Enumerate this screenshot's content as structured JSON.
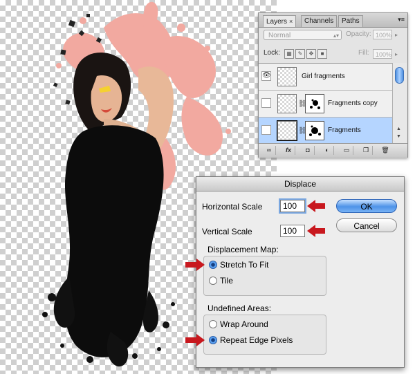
{
  "layers_panel": {
    "tabs": [
      {
        "label": "Layers",
        "close": "×",
        "active": true
      },
      {
        "label": "Channels",
        "active": false
      },
      {
        "label": "Paths",
        "active": false
      }
    ],
    "menu_glyph": "▾≡",
    "blend_mode": "Normal",
    "opacity_label": "Opacity:",
    "opacity_value": "100%",
    "lock_label": "Lock:",
    "fill_label": "Fill:",
    "fill_value": "100%",
    "layers": [
      {
        "name": "Girl fragments",
        "visible": true,
        "has_mask": false,
        "selected": false
      },
      {
        "name": "Fragments copy",
        "visible": false,
        "has_mask": true,
        "selected": false
      },
      {
        "name": "Fragments",
        "visible": false,
        "has_mask": true,
        "selected": true
      }
    ],
    "bottom_icons": [
      "link-icon",
      "fx-icon",
      "mask-icon",
      "adjustment-icon",
      "group-icon",
      "new-layer-icon",
      "trash-icon"
    ],
    "bottom_glyphs": [
      "∞",
      "fx",
      "◘",
      "◐",
      "▭",
      "❐",
      "🗑"
    ]
  },
  "displace_dialog": {
    "title": "Displace",
    "horizontal_scale_label": "Horizontal Scale",
    "horizontal_scale_value": "100",
    "vertical_scale_label": "Vertical Scale",
    "vertical_scale_value": "100",
    "ok_label": "OK",
    "cancel_label": "Cancel",
    "displacement_map_label": "Displacement Map:",
    "displacement_options": [
      "Stretch To Fit",
      "Tile"
    ],
    "displacement_selected": 0,
    "undefined_areas_label": "Undefined Areas:",
    "undefined_options": [
      "Wrap Around",
      "Repeat Edge Pixels"
    ],
    "undefined_selected": 1
  },
  "colors": {
    "accent_blue": "#4e93e8",
    "selected_layer": "#b5d5ff",
    "arrow_red": "#c8181e"
  }
}
